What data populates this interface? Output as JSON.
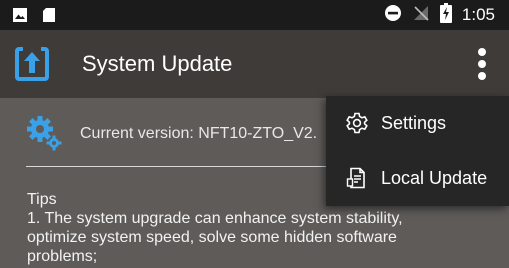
{
  "status_bar": {
    "time": "1:05",
    "icons": [
      "gallery-icon",
      "sd-card-icon",
      "do-not-disturb-icon",
      "no-signal-icon",
      "battery-charging-icon"
    ]
  },
  "app_bar": {
    "title": "System Update",
    "icon": "system-update-icon",
    "overflow_icon": "more-vert-icon"
  },
  "main": {
    "version_label": "Current version: NFT10-ZTO_V2.",
    "version_icon": "settings-gears-icon",
    "tips": {
      "heading": "Tips",
      "lines": [
        "1. The system upgrade can enhance system stability,",
        "optimize system speed, solve some hidden software",
        "problems;"
      ]
    }
  },
  "menu": {
    "items": [
      {
        "label": "Settings",
        "icon": "gear-icon"
      },
      {
        "label": "Local Update",
        "icon": "file-icon"
      }
    ]
  },
  "colors": {
    "status_bar": "#1b1b1b",
    "app_bar": "#3f3b38",
    "background": "#5e5b59",
    "menu": "#262626",
    "accent_blue": "#3aa0e8"
  }
}
